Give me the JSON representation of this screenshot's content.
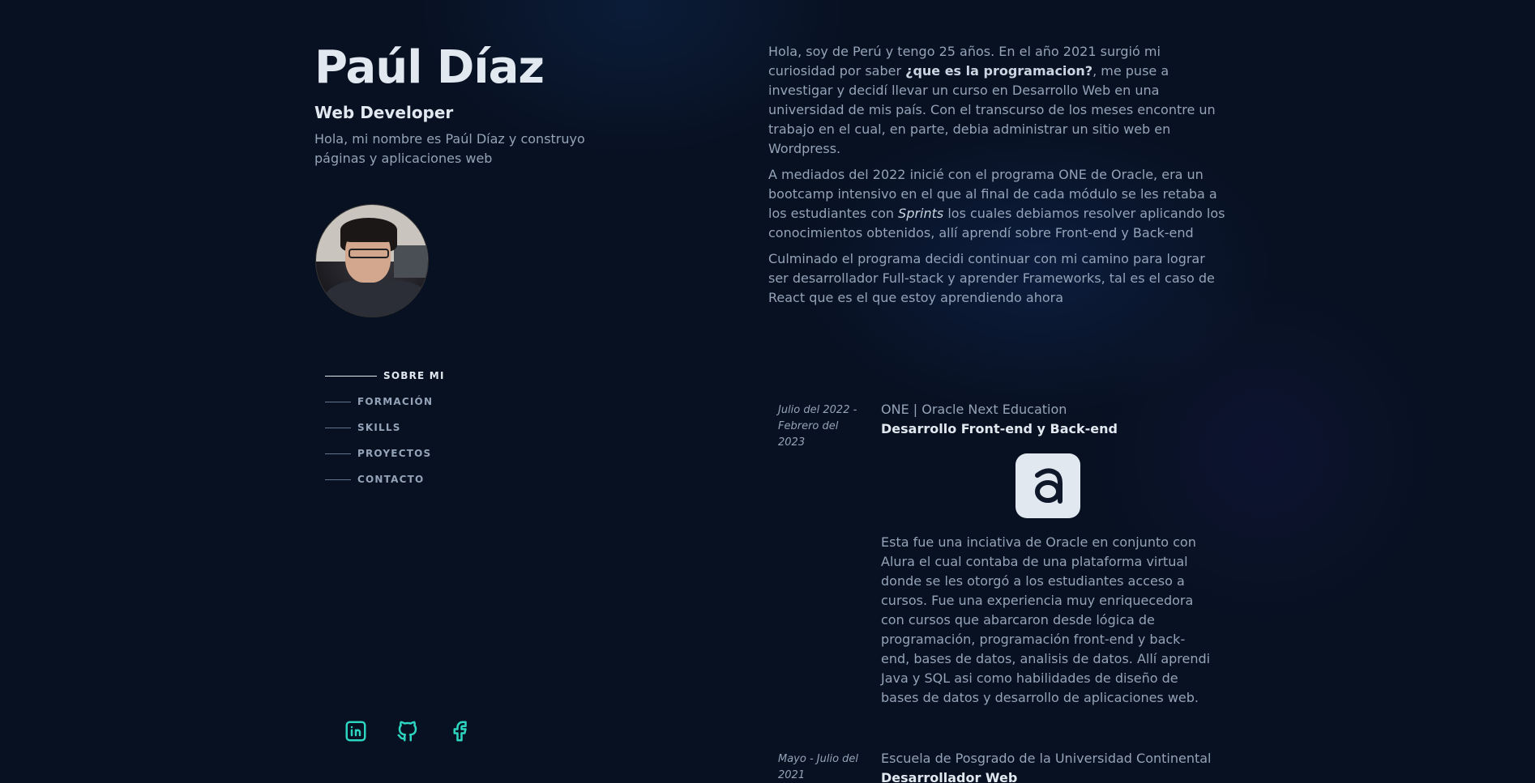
{
  "profile": {
    "name": "Paúl Díaz",
    "role": "Web Developer",
    "intro": "Hola, mi nombre es Paúl Díaz y construyo páginas y aplicaciones web"
  },
  "nav": {
    "items": [
      {
        "label": "SOBRE MI",
        "active": true
      },
      {
        "label": "FORMACIÓN",
        "active": false
      },
      {
        "label": "SKILLS",
        "active": false
      },
      {
        "label": "PROYECTOS",
        "active": false
      },
      {
        "label": "CONTACTO",
        "active": false
      }
    ]
  },
  "socials": [
    "linkedin-icon",
    "github-icon",
    "facebook-icon"
  ],
  "about": {
    "p1_before": "Hola, soy de Perú y tengo 25 años. En el año 2021 surgió mi curiosidad por saber ",
    "p1_bold": "¿que es la programacion?",
    "p1_after": ", me puse a investigar y decidí llevar un curso en Desarrollo Web en una universidad de mis país. Con el transcurso de los meses encontre un trabajo en el cual, en parte, debia administrar un sitio web en Wordpress.",
    "p2_before": "A mediados del 2022 inicié con el programa ONE de Oracle, era un bootcamp intensivo en el que al final de cada módulo se les retaba a los estudiantes con ",
    "p2_italic": "Sprints",
    "p2_after": " los cuales debiamos resolver aplicando los conocimientos obtenidos, allí aprendí sobre Front-end y Back-end",
    "p3": "Culminado el programa decidi continuar con mi camino para lograr ser desarrollador Full-stack y aprender Frameworks, tal es el caso de React que es el que estoy aprendiendo ahora"
  },
  "education": [
    {
      "date": "Julio del 2022 - Febrero del 2023",
      "org": "ONE | Oracle Next Education",
      "title": "Desarrollo Front-end y Back-end",
      "logo": "a",
      "description": "Esta fue una inciativa de Oracle en conjunto con Alura el cual contaba de una plataforma virtual donde se les otorgó a los estudiantes acceso a cursos. Fue una experiencia muy enriquecedora con cursos que abarcaron desde lógica de programación, programación front-end y back-end, bases de datos, analisis de datos. Allí aprendi Java y SQL asi como habilidades de diseño de bases de datos y desarrollo de aplicaciones web."
    },
    {
      "date": "Mayo - Julio del 2021",
      "org": "Escuela de Posgrado de la Universidad Continental",
      "title": "Desarrollador Web"
    }
  ],
  "colors": {
    "background": "#081122",
    "heading": "#e2e8f0",
    "text": "#94a3b8",
    "accent": "#2dd4bf"
  }
}
